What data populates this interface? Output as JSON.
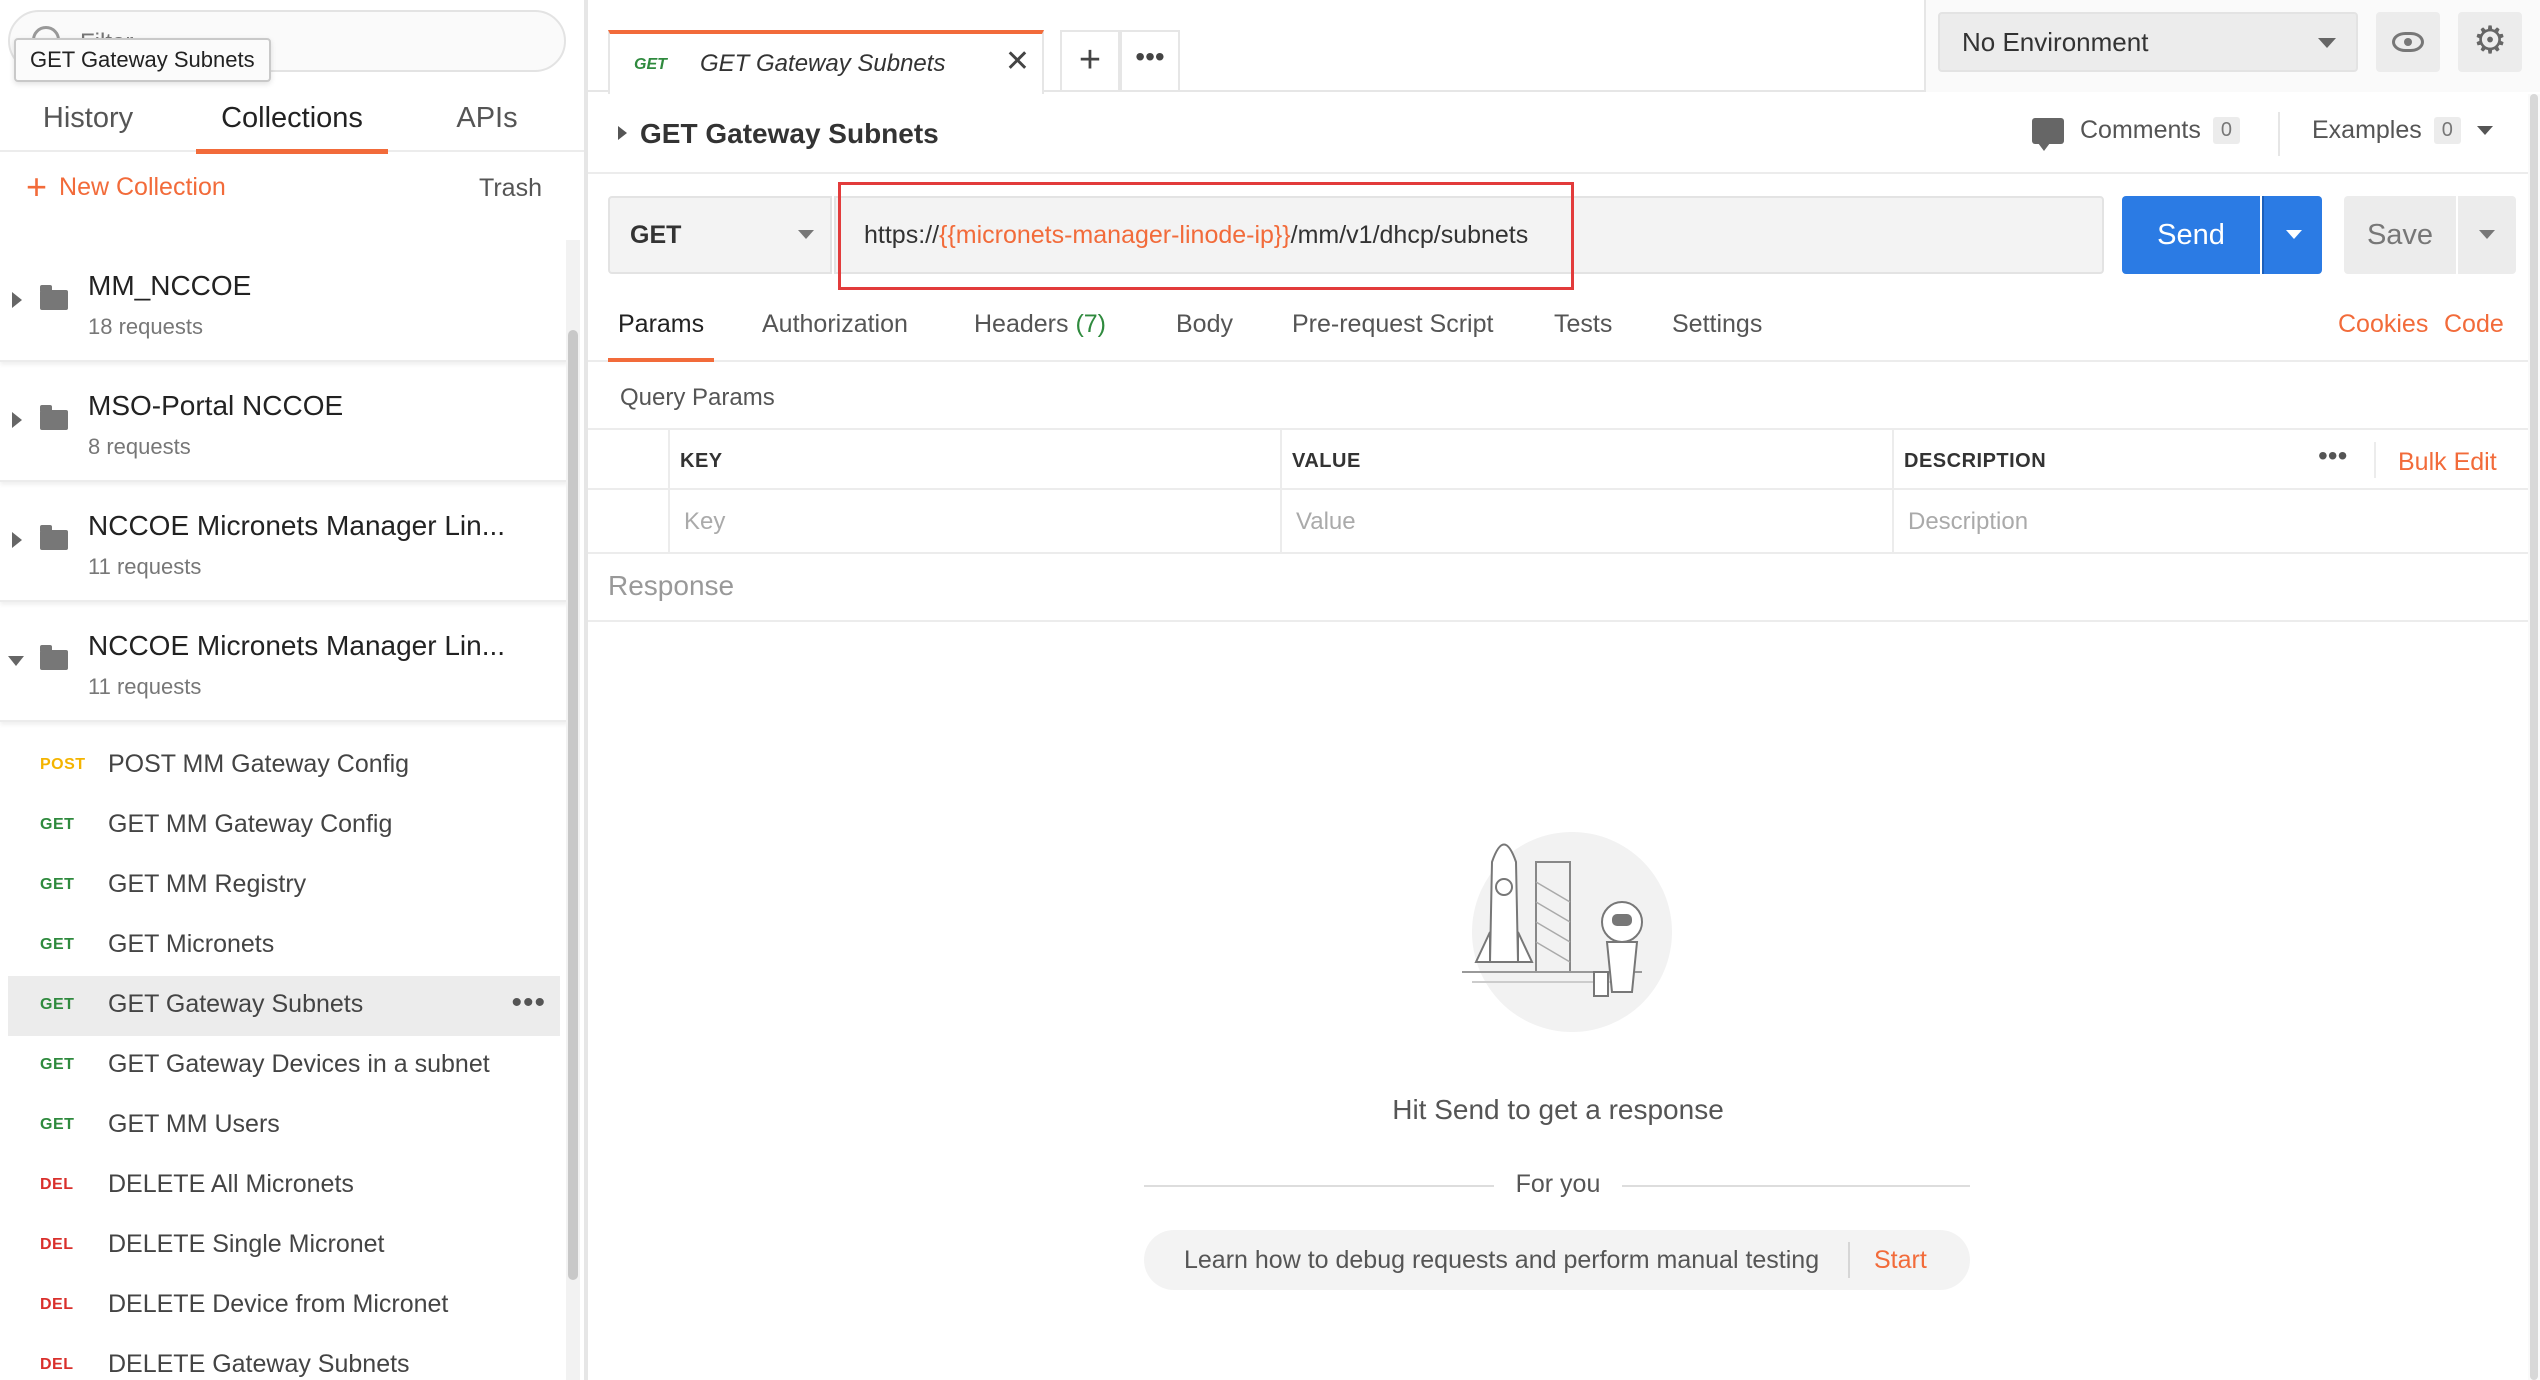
{
  "sidebar": {
    "search": {
      "placeholder": "Filter"
    },
    "tooltip": "GET Gateway Subnets",
    "tabs": [
      {
        "label": "History"
      },
      {
        "label": "Collections"
      },
      {
        "label": "APIs"
      }
    ],
    "active_tab": "Collections",
    "new_collection_label": "New Collection",
    "trash_label": "Trash",
    "collections": [
      {
        "name": "MM_NCCOE",
        "count": "18 requests",
        "expanded": false
      },
      {
        "name": "MSO-Portal NCCOE",
        "count": "8 requests",
        "expanded": false
      },
      {
        "name": "NCCOE Micronets Manager Lin...",
        "count": "11 requests",
        "expanded": false
      },
      {
        "name": "NCCOE Micronets Manager Lin...",
        "count": "11 requests",
        "expanded": true
      }
    ],
    "requests": [
      {
        "method": "POST",
        "name": "POST MM Gateway Config"
      },
      {
        "method": "GET",
        "name": "GET MM Gateway Config"
      },
      {
        "method": "GET",
        "name": "GET MM Registry"
      },
      {
        "method": "GET",
        "name": "GET Micronets"
      },
      {
        "method": "GET",
        "name": "GET Gateway Subnets",
        "selected": true,
        "more": "•••"
      },
      {
        "method": "GET",
        "name": "GET Gateway Devices in a subnet"
      },
      {
        "method": "GET",
        "name": "GET MM Users"
      },
      {
        "method": "DEL",
        "name": "DELETE All Micronets"
      },
      {
        "method": "DEL",
        "name": "DELETE Single Micronet"
      },
      {
        "method": "DEL",
        "name": "DELETE Device from Micronet"
      },
      {
        "method": "DEL",
        "name": "DELETE Gateway Subnets"
      }
    ]
  },
  "tabbar": {
    "tab": {
      "method": "GET",
      "name": "GET Gateway Subnets",
      "close": "✕"
    },
    "add": "+",
    "more": "•••",
    "environment": "No Environment",
    "gear": "⚙"
  },
  "request": {
    "title": "GET Gateway Subnets",
    "comments_label": "Comments",
    "comments_count": "0",
    "examples_label": "Examples",
    "examples_count": "0",
    "method": "GET",
    "url_prefix": "https://",
    "url_variable": "{{micronets-manager-linode-ip}}",
    "url_suffix": "/mm/v1/dhcp/subnets",
    "send_label": "Send",
    "save_label": "Save"
  },
  "subtabs": {
    "params": "Params",
    "authorization": "Authorization",
    "headers": "Headers",
    "headers_count": "(7)",
    "body": "Body",
    "prerequest": "Pre-request Script",
    "tests": "Tests",
    "settings": "Settings",
    "cookies": "Cookies",
    "code": "Code"
  },
  "query_params": {
    "title": "Query Params",
    "columns": [
      "KEY",
      "VALUE",
      "DESCRIPTION"
    ],
    "placeholders": [
      "Key",
      "Value",
      "Description"
    ],
    "more": "•••",
    "bulk_edit": "Bulk Edit"
  },
  "response": {
    "title": "Response",
    "hint": "Hit Send to get a response",
    "for_you": "For you",
    "learn_text": "Learn how to debug requests and perform manual testing",
    "start_label": "Start"
  },
  "colors": {
    "accent": "#f26b3a",
    "send_blue": "#2b7be4",
    "get_green": "#2f8a3e",
    "post_yellow": "#f4b400",
    "del_red": "#d9302c",
    "highlight_red": "#e23b3b"
  },
  "icons": [
    "search-icon",
    "plus-icon",
    "folder-icon",
    "chevron-right-icon",
    "chevron-down-icon",
    "close-icon",
    "eye-icon",
    "gear-icon",
    "comment-icon",
    "more-icon",
    "rocket-illustration"
  ]
}
